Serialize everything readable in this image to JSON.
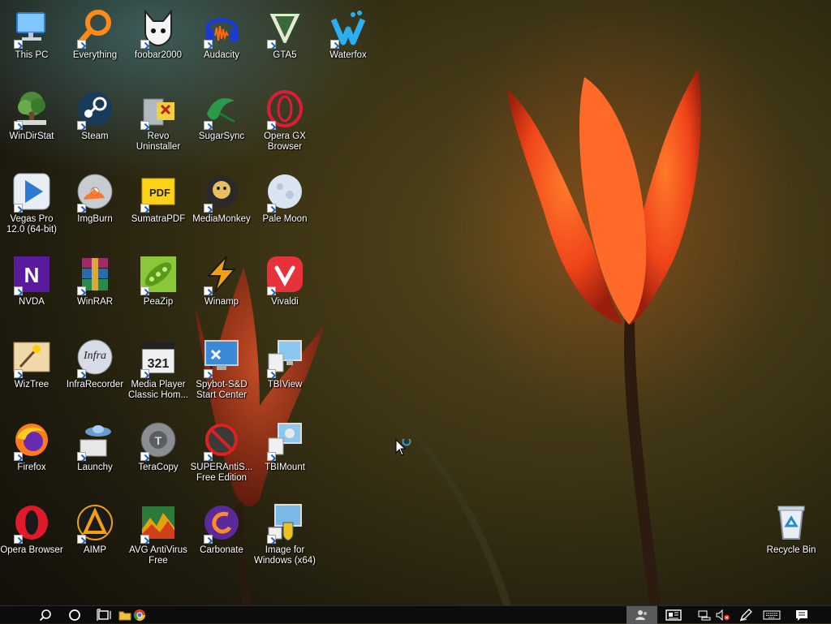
{
  "desktop": {
    "icons": [
      {
        "label": "This PC",
        "icon": "this-pc-icon"
      },
      {
        "label": "Everything",
        "icon": "everything-icon"
      },
      {
        "label": "foobar2000",
        "icon": "foobar2000-icon"
      },
      {
        "label": "Audacity",
        "icon": "audacity-icon"
      },
      {
        "label": "GTA5",
        "icon": "gta5-icon"
      },
      {
        "label": "Waterfox",
        "icon": "waterfox-icon"
      },
      {
        "label": "WinDirStat",
        "icon": "windirstat-icon"
      },
      {
        "label": "Steam",
        "icon": "steam-icon"
      },
      {
        "label": "Revo Uninstaller",
        "icon": "revo-uninstaller-icon"
      },
      {
        "label": "SugarSync",
        "icon": "sugarsync-icon"
      },
      {
        "label": "Opera GX Browser",
        "icon": "opera-gx-icon"
      },
      {
        "label": "Vegas Pro 12.0 (64-bit)",
        "icon": "vegas-pro-icon"
      },
      {
        "label": "ImgBurn",
        "icon": "imgburn-icon"
      },
      {
        "label": "SumatraPDF",
        "icon": "sumatrapdf-icon"
      },
      {
        "label": "MediaMonkey",
        "icon": "mediamonkey-icon"
      },
      {
        "label": "Pale Moon",
        "icon": "pale-moon-icon"
      },
      {
        "label": "NVDA",
        "icon": "nvda-icon"
      },
      {
        "label": "WinRAR",
        "icon": "winrar-icon"
      },
      {
        "label": "PeaZip",
        "icon": "peazip-icon"
      },
      {
        "label": "Winamp",
        "icon": "winamp-icon"
      },
      {
        "label": "Vivaldi",
        "icon": "vivaldi-icon"
      },
      {
        "label": "WizTree",
        "icon": "wiztree-icon"
      },
      {
        "label": "InfraRecorder",
        "icon": "infrarecorder-icon"
      },
      {
        "label": "Media Player Classic Hom...",
        "icon": "mpc-hc-icon"
      },
      {
        "label": "Spybot-S&D Start Center",
        "icon": "spybot-icon"
      },
      {
        "label": "TBIView",
        "icon": "tbiview-icon"
      },
      {
        "label": "Firefox",
        "icon": "firefox-icon"
      },
      {
        "label": "Launchy",
        "icon": "launchy-icon"
      },
      {
        "label": "TeraCopy",
        "icon": "teracopy-icon"
      },
      {
        "label": "SUPERAntiS... Free Edition",
        "icon": "superantispyware-icon"
      },
      {
        "label": "TBIMount",
        "icon": "tbimount-icon"
      },
      {
        "label": "Opera Browser",
        "icon": "opera-icon"
      },
      {
        "label": "AIMP",
        "icon": "aimp-icon"
      },
      {
        "label": "AVG AntiVirus Free",
        "icon": "avg-icon"
      },
      {
        "label": "Carbonate",
        "icon": "carbonate-icon"
      },
      {
        "label": "Image for Windows (x64)",
        "icon": "image-for-windows-icon"
      }
    ],
    "recycle_bin": {
      "label": "Recycle Bin",
      "icon": "recycle-bin-icon"
    }
  },
  "taskbar": {
    "left": [
      "search-icon",
      "cortana-icon",
      "task-view-icon",
      "file-explorer-icon",
      "chrome-icon"
    ],
    "tray": [
      "people-icon",
      "news-icon",
      "network-icon",
      "volume-muted-icon",
      "pen-icon",
      "keyboard-icon",
      "notifications-icon"
    ]
  },
  "colors": {
    "taskbar": "#0c0c0c",
    "label_text": "#ffffff",
    "shortcut_arrow": "#1a5fd0"
  }
}
